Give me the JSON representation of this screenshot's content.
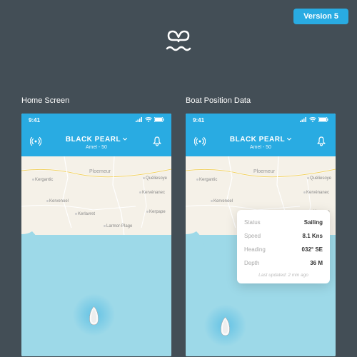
{
  "version_label": "Version 5",
  "screens": {
    "home": {
      "label": "Home Screen"
    },
    "data": {
      "label": "Boat Position Data"
    }
  },
  "status": {
    "time": "9:41"
  },
  "header": {
    "boat_name": "BLACK PEARL",
    "boat_model": "Amel - 50"
  },
  "map": {
    "towns": {
      "ploemeur": "Ploemeur",
      "kergantic": "Kergantic",
      "kervenoel": "Kervenoel",
      "kerlavret": "Kerlavret",
      "kervenanec": "Kervénanec",
      "larmor": "Larmor-Plage",
      "queliesoye": "Quéliesoye",
      "kerpape": "Kerpape"
    }
  },
  "data_card": {
    "rows": [
      {
        "label": "Status",
        "value": "Sailing"
      },
      {
        "label": "Speed",
        "value": "8.1 Kns"
      },
      {
        "label": "Heading",
        "value": "032° SE"
      },
      {
        "label": "Depth",
        "value": "36 M"
      }
    ],
    "updated": "Last updated: 2 min ago"
  },
  "colors": {
    "accent": "#29abe2",
    "bg": "#434e56",
    "sea": "#9dd9e8",
    "land": "#f5f1e8"
  }
}
